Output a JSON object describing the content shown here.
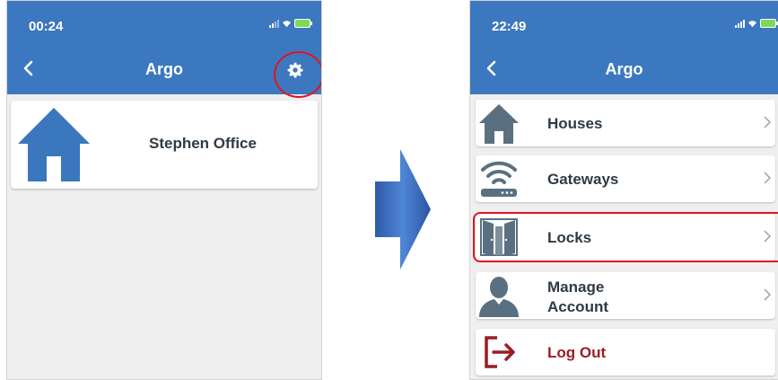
{
  "left_screen": {
    "status_time": "00:24",
    "nav_title": "Argo",
    "house_label": "Stephen Office"
  },
  "right_screen": {
    "status_time": "22:49",
    "nav_title": "Argo",
    "menu": [
      {
        "label": "Houses",
        "icon": "house-icon"
      },
      {
        "label": "Gateways",
        "icon": "gateway-icon"
      },
      {
        "label": "Locks",
        "icon": "doors-icon"
      },
      {
        "label": "Manage Account",
        "icon": "person-icon"
      },
      {
        "label": "Log Out",
        "icon": "logout-icon"
      }
    ]
  },
  "colors": {
    "nav_bar": "#3c78bf",
    "house_icon": "#3a77bd",
    "menu_icon": "#5a7080",
    "logout": "#9b1c25",
    "highlight": "#e0141e"
  }
}
